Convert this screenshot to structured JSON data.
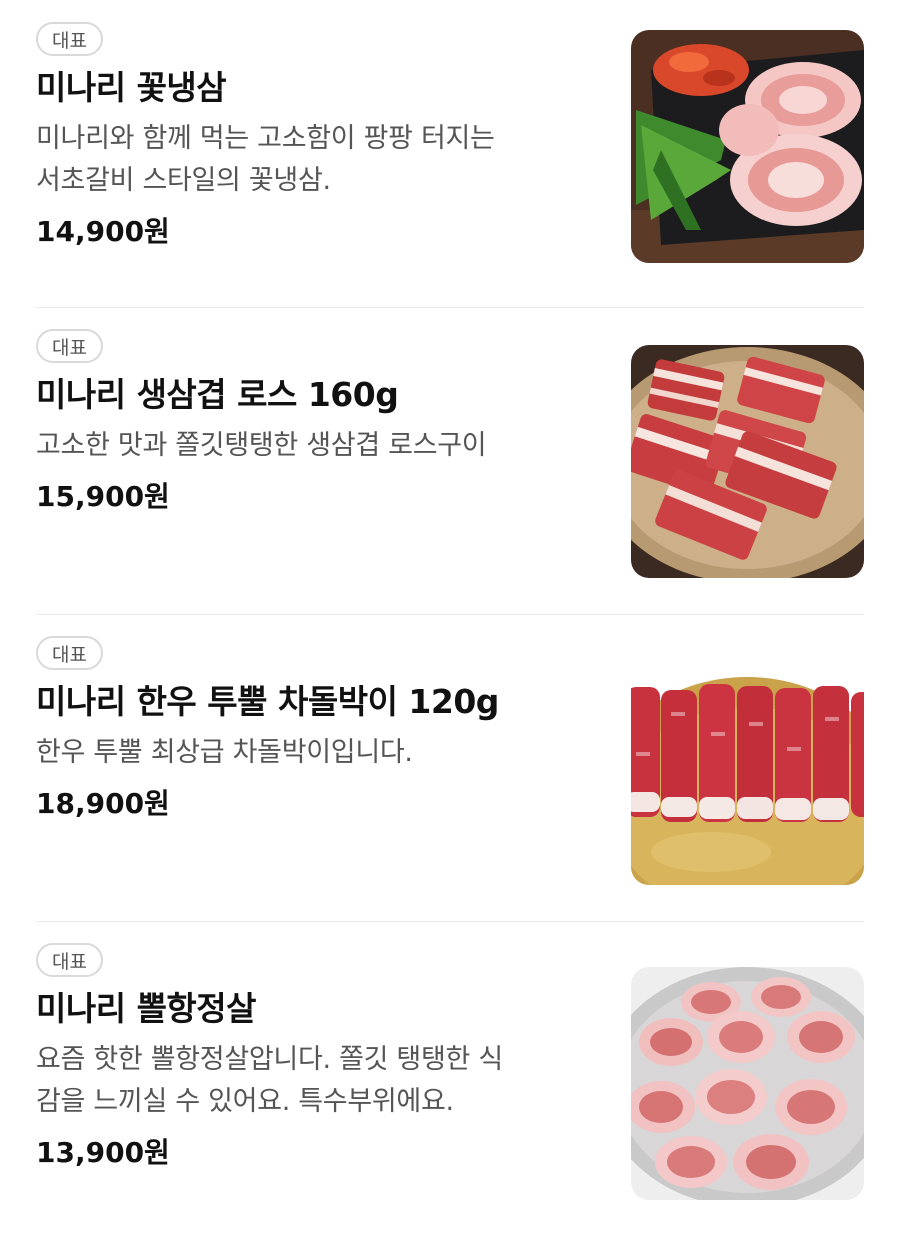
{
  "menu": {
    "items": [
      {
        "badge": "대표",
        "name": "미나리 꽃냉삼",
        "description_lines": [
          "미나리와 함께 먹는 고소함이 팡팡 터지는",
          "서초갈비 스타일의 꽃냉삼."
        ],
        "price": "14,900원",
        "image_icon": "pork-belly-rolls-with-minari-image"
      },
      {
        "badge": "대표",
        "name": "미나리 생삼겹 로스 160g",
        "description_lines": [
          "고소한 맛과 쫄깃탱탱한 생삼겹 로스구이"
        ],
        "price": "15,900원",
        "image_icon": "pork-belly-slabs-image"
      },
      {
        "badge": "대표",
        "name": "미나리 한우 투뿔 차돌박이 120g",
        "description_lines": [
          "한우 투뿔 최상급 차돌박이입니다."
        ],
        "price": "18,900원",
        "image_icon": "beef-brisket-rolls-image"
      },
      {
        "badge": "대표",
        "name": "미나리 뽈항정살",
        "description_lines": [
          "요즘 핫한 뽈항정살압니다. 쫄깃 탱탱한 식",
          "감을 느끼실 수 있어요. 특수부위에요."
        ],
        "price": "13,900원",
        "image_icon": "pork-jowl-rounds-image"
      }
    ]
  },
  "colors": {
    "text_primary": "#111111",
    "text_secondary": "#555555",
    "badge_border": "#d9d9d9",
    "divider": "#ececec"
  }
}
